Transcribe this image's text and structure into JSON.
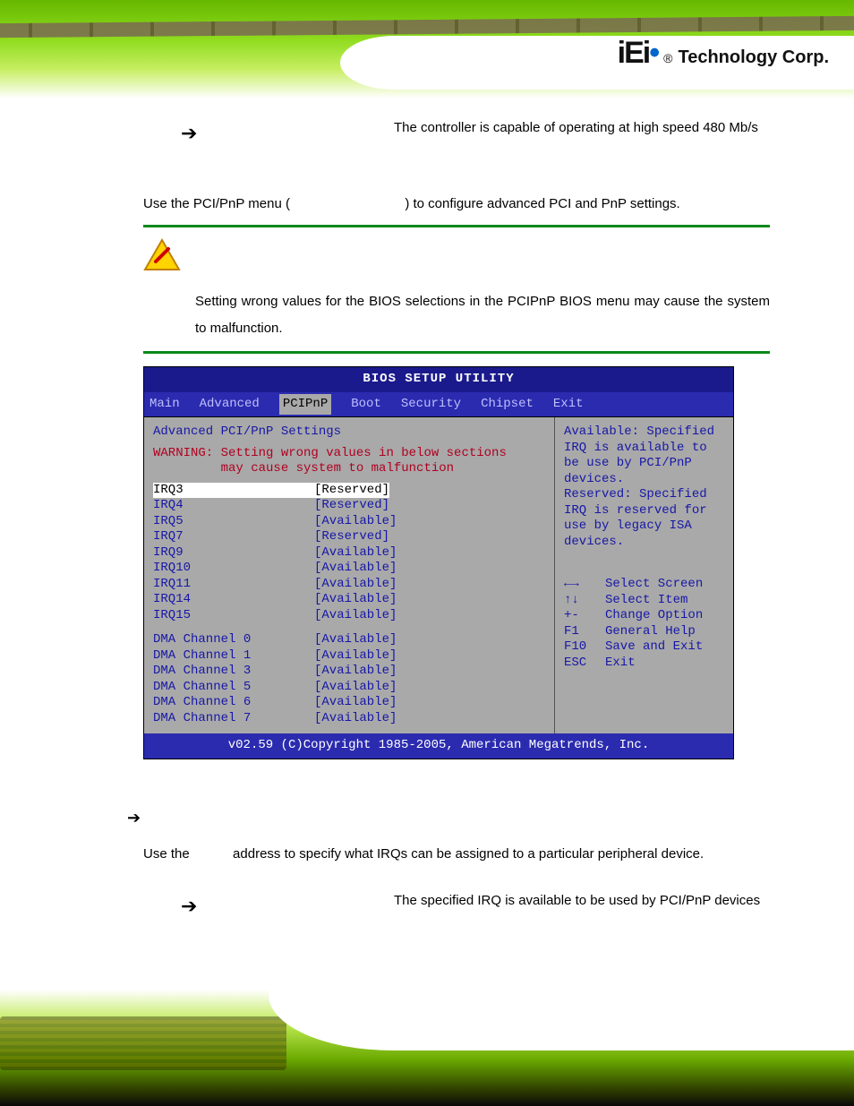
{
  "header": {
    "logo_mark": "iEi",
    "logo_reg": "®",
    "logo_text": "Technology Corp."
  },
  "top_bullet": {
    "label": "",
    "desc": "The controller is capable of operating at high speed 480 Mb/s"
  },
  "pcipnp": {
    "intro_prefix": "Use the PCI/PnP menu (",
    "intro_suffix": ") to configure advanced PCI and PnP settings.",
    "warning": "Setting wrong values for the BIOS selections in the PCIPnP BIOS menu may cause the system to malfunction."
  },
  "bios": {
    "title": "BIOS SETUP UTILITY",
    "tabs": [
      "Main",
      "Advanced",
      "PCIPnP",
      "Boot",
      "Security",
      "Chipset",
      "Exit"
    ],
    "active_tab": "PCIPnP",
    "section_header": "Advanced PCI/PnP Settings",
    "warning_line1": "WARNING: Setting wrong values in below sections",
    "warning_line2": "         may cause system to malfunction",
    "irq_rows": [
      {
        "name": "IRQ3",
        "value": "[Reserved]",
        "hi": true
      },
      {
        "name": "IRQ4",
        "value": "[Reserved]"
      },
      {
        "name": "IRQ5",
        "value": "[Available]"
      },
      {
        "name": "IRQ7",
        "value": "[Reserved]"
      },
      {
        "name": "IRQ9",
        "value": "[Available]"
      },
      {
        "name": "IRQ10",
        "value": "[Available]"
      },
      {
        "name": "IRQ11",
        "value": "[Available]"
      },
      {
        "name": "IRQ14",
        "value": "[Available]"
      },
      {
        "name": "IRQ15",
        "value": "[Available]"
      }
    ],
    "dma_rows": [
      {
        "name": "DMA Channel 0",
        "value": "[Available]"
      },
      {
        "name": "DMA Channel 1",
        "value": "[Available]"
      },
      {
        "name": "DMA Channel 3",
        "value": "[Available]"
      },
      {
        "name": "DMA Channel 5",
        "value": "[Available]"
      },
      {
        "name": "DMA Channel 6",
        "value": "[Available]"
      },
      {
        "name": "DMA Channel 7",
        "value": "[Available]"
      }
    ],
    "help_text": "Available: Specified IRQ is available to be use by PCI/PnP devices.\nReserved: Specified IRQ is reserved for use by legacy ISA devices.",
    "keys": [
      {
        "k": "←→",
        "v": "Select Screen"
      },
      {
        "k": "↑↓",
        "v": "Select Item"
      },
      {
        "k": "+-",
        "v": "Change Option"
      },
      {
        "k": "F1",
        "v": "General Help"
      },
      {
        "k": "F10",
        "v": "Save and Exit"
      },
      {
        "k": "ESC",
        "v": "Exit"
      }
    ],
    "footer": "v02.59 (C)Copyright 1985-2005, American Megatrends, Inc."
  },
  "irq_section": {
    "para_prefix": "Use the ",
    "para_suffix": " address to specify what IRQs can be assigned to a particular peripheral device.",
    "available_desc": "The specified IRQ is available to be used by PCI/PnP devices"
  }
}
